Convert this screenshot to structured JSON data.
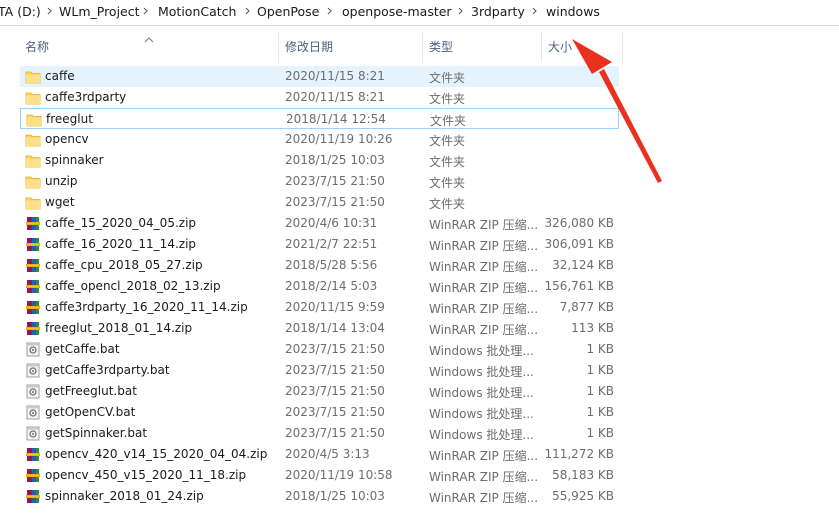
{
  "breadcrumb": [
    {
      "label": "TA (D:)"
    },
    {
      "label": "WLm_Project"
    },
    {
      "label": "MotionCatch"
    },
    {
      "label": "OpenPose"
    },
    {
      "label": "openpose-master"
    },
    {
      "label": "3rdparty"
    },
    {
      "label": "windows"
    }
  ],
  "columns": {
    "name": "名称",
    "date": "修改日期",
    "type": "类型",
    "size": "大小"
  },
  "files": [
    {
      "name": "caffe",
      "date": "2020/11/15 8:21",
      "type": "文件夹",
      "size": "",
      "icon": "folder-icon"
    },
    {
      "name": "caffe3rdparty",
      "date": "2020/11/15 8:21",
      "type": "文件夹",
      "size": "",
      "icon": "folder-icon"
    },
    {
      "name": "freeglut",
      "date": "2018/1/14 12:54",
      "type": "文件夹",
      "size": "",
      "icon": "folder-icon"
    },
    {
      "name": "opencv",
      "date": "2020/11/19 10:26",
      "type": "文件夹",
      "size": "",
      "icon": "folder-icon"
    },
    {
      "name": "spinnaker",
      "date": "2018/1/25 10:03",
      "type": "文件夹",
      "size": "",
      "icon": "folder-icon"
    },
    {
      "name": "unzip",
      "date": "2023/7/15 21:50",
      "type": "文件夹",
      "size": "",
      "icon": "folder-icon"
    },
    {
      "name": "wget",
      "date": "2023/7/15 21:50",
      "type": "文件夹",
      "size": "",
      "icon": "folder-icon"
    },
    {
      "name": "caffe_15_2020_04_05.zip",
      "date": "2020/4/6 10:31",
      "type": "WinRAR ZIP 压缩...",
      "size": "326,080 KB",
      "icon": "winrar-zip-icon"
    },
    {
      "name": "caffe_16_2020_11_14.zip",
      "date": "2021/2/7 22:51",
      "type": "WinRAR ZIP 压缩...",
      "size": "306,091 KB",
      "icon": "winrar-zip-icon"
    },
    {
      "name": "caffe_cpu_2018_05_27.zip",
      "date": "2018/5/28 5:56",
      "type": "WinRAR ZIP 压缩...",
      "size": "32,124 KB",
      "icon": "winrar-zip-icon"
    },
    {
      "name": "caffe_opencl_2018_02_13.zip",
      "date": "2018/2/14 5:03",
      "type": "WinRAR ZIP 压缩...",
      "size": "156,761 KB",
      "icon": "winrar-zip-icon"
    },
    {
      "name": "caffe3rdparty_16_2020_11_14.zip",
      "date": "2020/11/15 9:59",
      "type": "WinRAR ZIP 压缩...",
      "size": "7,877 KB",
      "icon": "winrar-zip-icon"
    },
    {
      "name": "freeglut_2018_01_14.zip",
      "date": "2018/1/14 13:04",
      "type": "WinRAR ZIP 压缩...",
      "size": "113 KB",
      "icon": "winrar-zip-icon"
    },
    {
      "name": "getCaffe.bat",
      "date": "2023/7/15 21:50",
      "type": "Windows 批处理...",
      "size": "1 KB",
      "icon": "bat-file-icon"
    },
    {
      "name": "getCaffe3rdparty.bat",
      "date": "2023/7/15 21:50",
      "type": "Windows 批处理...",
      "size": "1 KB",
      "icon": "bat-file-icon"
    },
    {
      "name": "getFreeglut.bat",
      "date": "2023/7/15 21:50",
      "type": "Windows 批处理...",
      "size": "1 KB",
      "icon": "bat-file-icon"
    },
    {
      "name": "getOpenCV.bat",
      "date": "2023/7/15 21:50",
      "type": "Windows 批处理...",
      "size": "1 KB",
      "icon": "bat-file-icon"
    },
    {
      "name": "getSpinnaker.bat",
      "date": "2023/7/15 21:50",
      "type": "Windows 批处理...",
      "size": "1 KB",
      "icon": "bat-file-icon"
    },
    {
      "name": "opencv_420_v14_15_2020_04_04.zip",
      "date": "2020/4/5 3:13",
      "type": "WinRAR ZIP 压缩...",
      "size": "111,272 KB",
      "icon": "winrar-zip-icon"
    },
    {
      "name": "opencv_450_v15_2020_11_18.zip",
      "date": "2020/11/19 10:58",
      "type": "WinRAR ZIP 压缩...",
      "size": "58,183 KB",
      "icon": "winrar-zip-icon"
    },
    {
      "name": "spinnaker_2018_01_24.zip",
      "date": "2018/1/25 10:03",
      "type": "WinRAR ZIP 压缩...",
      "size": "55,925 KB",
      "icon": "winrar-zip-icon"
    }
  ],
  "state": {
    "selected_row": 0,
    "focused_row": 2,
    "sort_column": "name"
  },
  "colors": {
    "selection_bg": "#e5f3ff",
    "focus_border": "#99d1ff",
    "folder": "#ffd35c",
    "header_text": "#4d6082",
    "annotation_arrow": "#e8311f"
  }
}
